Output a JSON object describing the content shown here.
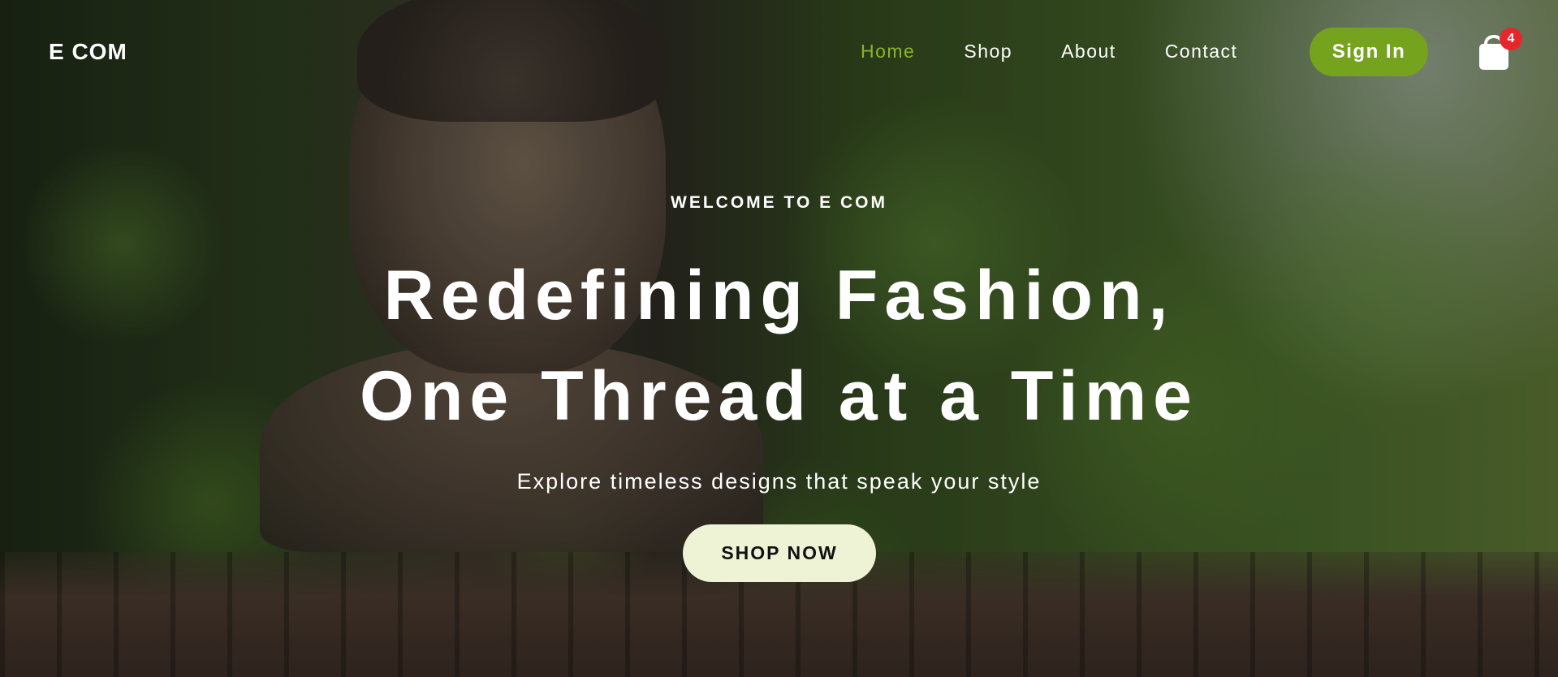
{
  "brand": {
    "logo": "E COM"
  },
  "nav": {
    "links": [
      {
        "label": "Home",
        "active": true
      },
      {
        "label": "Shop",
        "active": false
      },
      {
        "label": "About",
        "active": false
      },
      {
        "label": "Contact",
        "active": false
      }
    ],
    "signin_label": "Sign In",
    "cart_count": "4"
  },
  "hero": {
    "eyebrow": "WELCOME TO E COM",
    "headline_line1": "Redefining Fashion,",
    "headline_line2": "One Thread at a Time",
    "subheading": "Explore timeless designs that speak your style",
    "cta_label": "SHOP NOW"
  },
  "colors": {
    "accent": "#76a31d",
    "active_link": "#8ab42a",
    "badge": "#e5262b",
    "cta_bg": "#eef3d6"
  },
  "icons": {
    "cart": "shopping-bag-icon"
  }
}
